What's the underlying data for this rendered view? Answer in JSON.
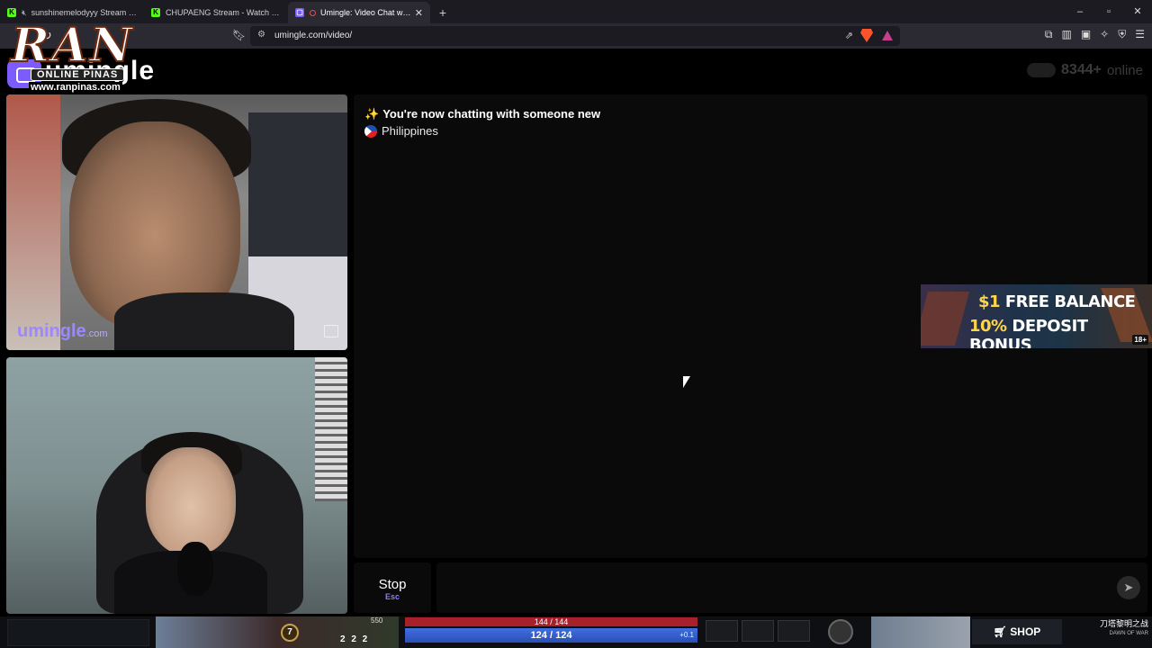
{
  "browser": {
    "tabs": [
      {
        "label": "sunshinemelodyyy Stream - Watch",
        "favicon": "kick-icon",
        "muted": true
      },
      {
        "label": "CHUPAENG Stream - Watch Live",
        "favicon": "kick-icon",
        "muted": true
      },
      {
        "label": "Umingle: Video Chat with Stra",
        "favicon": "umingle-icon",
        "recording": true,
        "active": true
      }
    ],
    "new_tab": "+",
    "url": "umingle.com/video/",
    "window_controls": [
      "–",
      "▫",
      "✕"
    ]
  },
  "site": {
    "logo_text": "umingle",
    "overlay_logo": {
      "title": "RAN",
      "subtitle": "ONLINE PINAS",
      "url": "www.ranpinas.com"
    },
    "online_count": "8344+",
    "online_label": "online"
  },
  "videos": {
    "watermark_main": "umingle",
    "watermark_suffix": ".com"
  },
  "chat": {
    "status_message": "You're now chatting with someone new",
    "country": "Philippines",
    "message_placeholder": ""
  },
  "ad": {
    "line1_highlight": "$1",
    "line1_text": "FREE BALANCE",
    "line2_highlight": "10%",
    "line2_text": "DEPOSIT BONUS",
    "age_badge": "18+"
  },
  "controls": {
    "stop_label": "Stop",
    "stop_shortcut": "Esc"
  },
  "game_hud": {
    "level": "7",
    "gold": "550",
    "kda": "2 2 2",
    "hp": "144 / 144",
    "mana": "124 / 124",
    "mana_regen": "+0.1",
    "shop_label": "SHOP",
    "event_title": "刀塔黎明之战",
    "event_subtitle": "DAWN OF WAR"
  }
}
